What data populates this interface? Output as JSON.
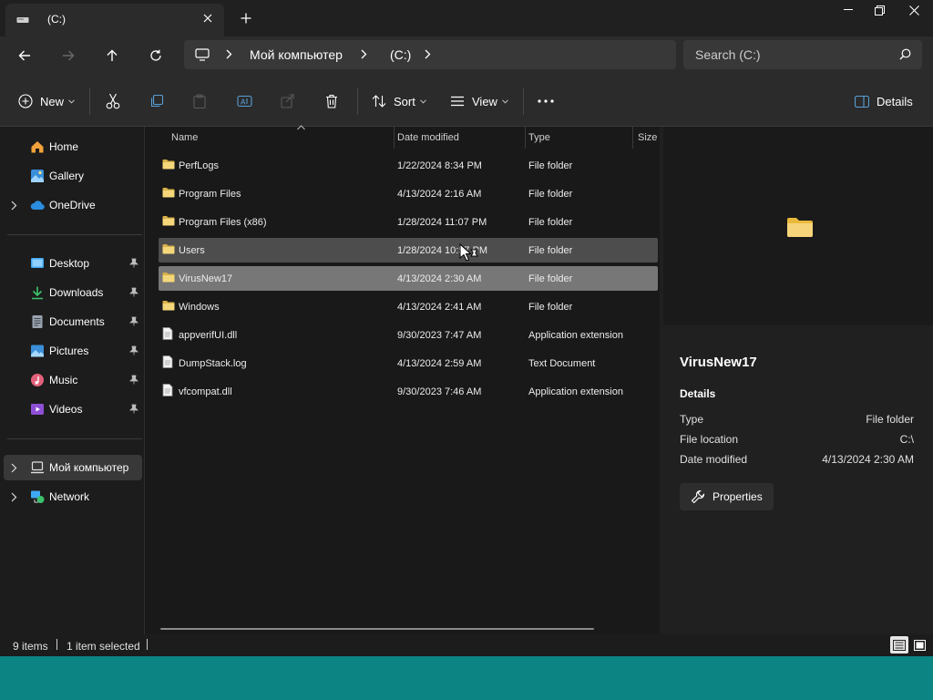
{
  "tab": {
    "title": "(C:)"
  },
  "address": {
    "crumbs": [
      "Мой компьютер",
      "(C:)"
    ]
  },
  "search": {
    "placeholder": "Search (C:)"
  },
  "toolbar": {
    "new_label": "New",
    "sort_label": "Sort",
    "view_label": "View",
    "details_label": "Details"
  },
  "nav": {
    "items": [
      {
        "label": "Home",
        "icon": "home-icon"
      },
      {
        "label": "Gallery",
        "icon": "gallery-icon"
      },
      {
        "label": "OneDrive",
        "icon": "cloud-icon"
      },
      {
        "label": "Desktop",
        "icon": "desktop-icon"
      },
      {
        "label": "Downloads",
        "icon": "download-icon"
      },
      {
        "label": "Documents",
        "icon": "document-icon"
      },
      {
        "label": "Pictures",
        "icon": "picture-icon"
      },
      {
        "label": "Music",
        "icon": "music-icon"
      },
      {
        "label": "Videos",
        "icon": "video-icon"
      },
      {
        "label": "Мой компьютер",
        "icon": "computer-icon"
      },
      {
        "label": "Network",
        "icon": "network-icon"
      }
    ]
  },
  "filelist": {
    "columns": {
      "name": "Name",
      "date": "Date modified",
      "type": "Type",
      "size": "Size"
    },
    "rows": [
      {
        "name": "PerfLogs",
        "date": "1/22/2024 8:34 PM",
        "type": "File folder",
        "icon": "folder-icon"
      },
      {
        "name": "Program Files",
        "date": "4/13/2024 2:16 AM",
        "type": "File folder",
        "icon": "folder-icon"
      },
      {
        "name": "Program Files (x86)",
        "date": "1/28/2024 11:07 PM",
        "type": "File folder",
        "icon": "folder-icon"
      },
      {
        "name": "Users",
        "date": "1/28/2024 10:57 PM",
        "type": "File folder",
        "icon": "folder-icon"
      },
      {
        "name": "VirusNew17",
        "date": "4/13/2024 2:30 AM",
        "type": "File folder",
        "icon": "folder-icon"
      },
      {
        "name": "Windows",
        "date": "4/13/2024 2:41 AM",
        "type": "File folder",
        "icon": "folder-icon"
      },
      {
        "name": "appverifUI.dll",
        "date": "9/30/2023 7:47 AM",
        "type": "Application extension",
        "icon": "file-icon"
      },
      {
        "name": "DumpStack.log",
        "date": "4/13/2024 2:59 AM",
        "type": "Text Document",
        "icon": "file-icon"
      },
      {
        "name": "vfcompat.dll",
        "date": "9/30/2023 7:46 AM",
        "type": "Application extension",
        "icon": "file-icon"
      }
    ]
  },
  "details": {
    "title": "VirusNew17",
    "section": "Details",
    "props": [
      {
        "key": "Type",
        "value": "File folder"
      },
      {
        "key": "File location",
        "value": "C:\\"
      },
      {
        "key": "Date modified",
        "value": "4/13/2024 2:30 AM"
      }
    ],
    "properties_label": "Properties"
  },
  "status": {
    "count": "9 items",
    "selected": "1 item selected"
  },
  "colors": {
    "folder": "#f4d77a",
    "accent": "#0d8484"
  }
}
